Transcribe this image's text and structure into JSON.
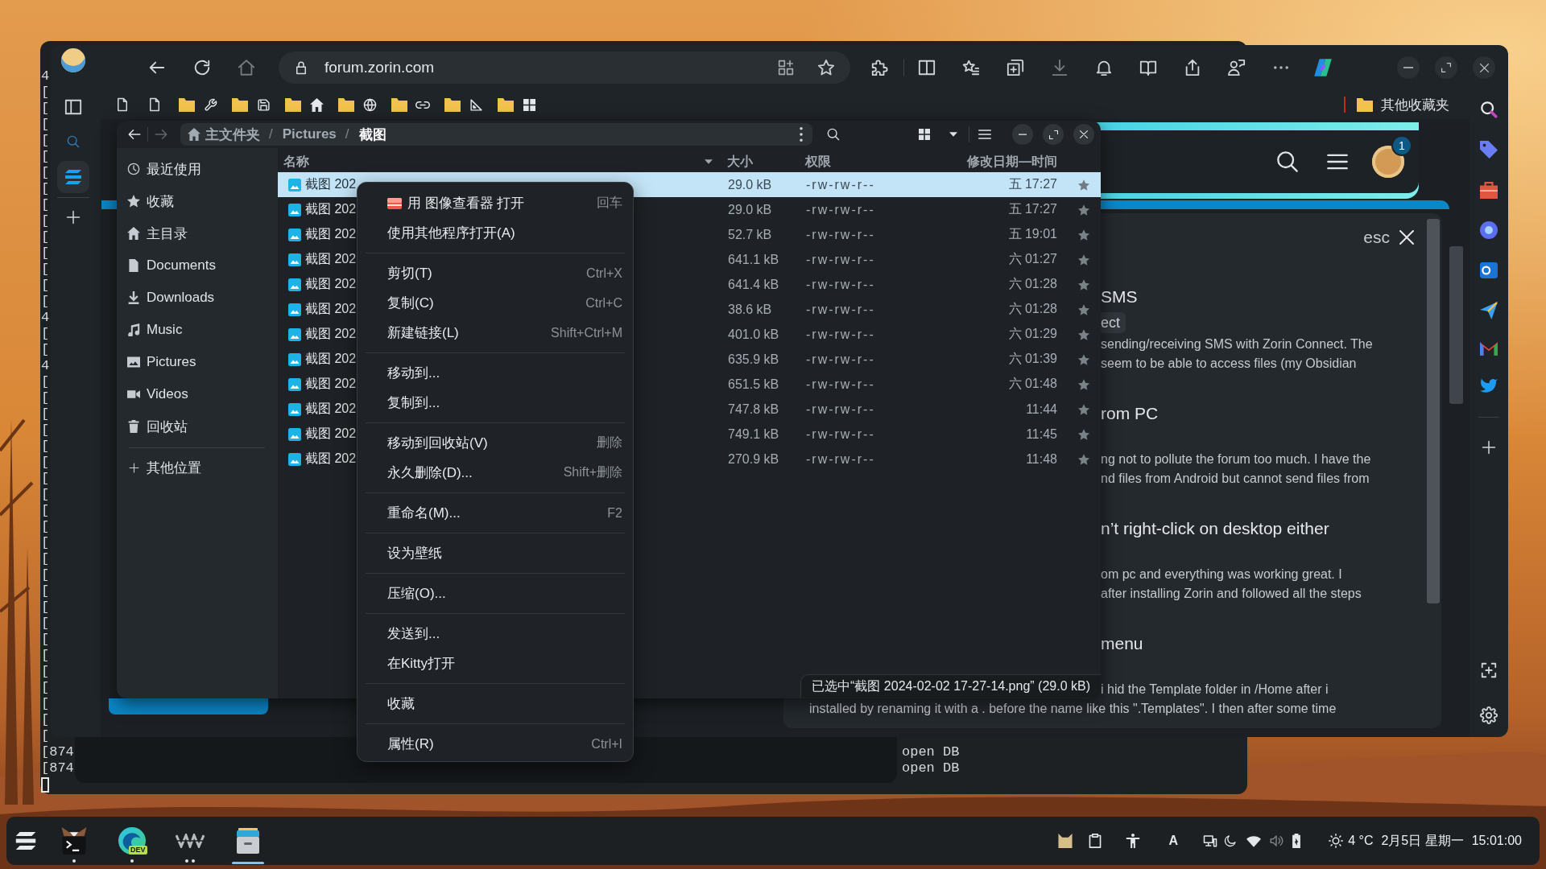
{
  "terminal": {
    "edge_lines": [
      "4",
      "[",
      "[",
      "[",
      "[",
      "[",
      "[",
      "[",
      "[",
      "[",
      "[",
      "[",
      "[",
      "[",
      "[",
      "4",
      "[",
      "[",
      "4",
      "[",
      "[",
      "[",
      "[",
      "[",
      "[",
      "[",
      "[",
      "[",
      "[",
      "[",
      "[",
      "[",
      "[",
      "[",
      "[",
      "[",
      "[",
      "[",
      "[",
      "[",
      "[",
      "["
    ],
    "bottom_lines": [
      {
        "start": "[874",
        "end": "open DB"
      },
      {
        "start": "[874",
        "end": "open DB"
      }
    ]
  },
  "browser": {
    "address": "forum.zorin.com",
    "other_bookmarks": "其他收藏夹",
    "page": {
      "notification_count": "1",
      "close_hint": "esc",
      "results": [
        {
          "kind": "heading",
          "text": "SMS"
        },
        {
          "kind": "tag",
          "text": "ect"
        },
        {
          "kind": "text",
          "text": "sending/receiving SMS with Zorin Connect. The"
        },
        {
          "kind": "text",
          "text": "seem to be able to access files (my Obsidian"
        },
        {
          "kind": "heading",
          "text": "rom PC"
        },
        {
          "kind": "text",
          "text": "ng not to pollute the forum too much. I have the"
        },
        {
          "kind": "text",
          "text": "nd files from Android but cannot send files from"
        },
        {
          "kind": "heading",
          "text": "n’t right-click on desktop either"
        },
        {
          "kind": "text",
          "text": "om pc and everything was working great. I"
        },
        {
          "kind": "text",
          "text": "after installing Zorin and followed all the steps"
        },
        {
          "kind": "heading",
          "text": "menu"
        },
        {
          "kind": "text",
          "text": "i hid the Template folder in /Home after i"
        }
      ],
      "last_line": "installed by renaming it with a . before the name like this \".Templates\". I then after some time"
    }
  },
  "file_manager": {
    "forward_disabled": true,
    "path": [
      {
        "kind": "home",
        "label": "主文件夹",
        "selected": false
      },
      {
        "kind": "folder",
        "separator": "/",
        "label": "Pictures",
        "selected": false
      },
      {
        "kind": "folder",
        "separator": "/",
        "label": "截图",
        "selected": true
      }
    ],
    "sidebar": [
      {
        "label": "最近使用",
        "selected": false
      },
      {
        "label": "收藏",
        "selected": false
      },
      {
        "label": "主目录",
        "selected": false
      },
      {
        "label": "Documents",
        "selected": false
      },
      {
        "label": "Downloads",
        "selected": false
      },
      {
        "label": "Music",
        "selected": false
      },
      {
        "label": "Pictures",
        "selected": false
      },
      {
        "label": "Videos",
        "selected": false
      },
      {
        "label": "回收站",
        "selected": false
      }
    ],
    "other_places": {
      "label": "其他位置",
      "selected": false
    },
    "columns": [
      {
        "label": "名称",
        "sorted": true
      },
      {
        "label": "大小",
        "sorted": false
      },
      {
        "label": "权限",
        "sorted": false
      },
      {
        "label": "修改日期—时间",
        "sorted": false
      }
    ],
    "rows": [
      {
        "name": "截图 202",
        "size": "29.0 kB",
        "permissions": "-rw-rw-r--",
        "modified": "五 17:27",
        "selected": true
      },
      {
        "name": "截图 202",
        "size": "29.0 kB",
        "permissions": "-rw-rw-r--",
        "modified": "五 17:27",
        "selected": false
      },
      {
        "name": "截图 202",
        "size": "52.7 kB",
        "permissions": "-rw-rw-r--",
        "modified": "五 19:01",
        "selected": false
      },
      {
        "name": "截图 202",
        "size": "641.1 kB",
        "permissions": "-rw-rw-r--",
        "modified": "六 01:27",
        "selected": false
      },
      {
        "name": "截图 202",
        "size": "641.4 kB",
        "permissions": "-rw-rw-r--",
        "modified": "六 01:28",
        "selected": false
      },
      {
        "name": "截图 202",
        "size": "38.6 kB",
        "permissions": "-rw-rw-r--",
        "modified": "六 01:28",
        "selected": false
      },
      {
        "name": "截图 202",
        "size": "401.0 kB",
        "permissions": "-rw-rw-r--",
        "modified": "六 01:29",
        "selected": false
      },
      {
        "name": "截图 202",
        "size": "635.9 kB",
        "permissions": "-rw-rw-r--",
        "modified": "六 01:39",
        "selected": false
      },
      {
        "name": "截图 202",
        "size": "651.5 kB",
        "permissions": "-rw-rw-r--",
        "modified": "六 01:48",
        "selected": false
      },
      {
        "name": "截图 202",
        "size": "747.8 kB",
        "permissions": "-rw-rw-r--",
        "modified": "11:44",
        "selected": false
      },
      {
        "name": "截图 202",
        "size": "749.1 kB",
        "permissions": "-rw-rw-r--",
        "modified": "11:45",
        "selected": false
      },
      {
        "name": "截图 202",
        "size": "270.9 kB",
        "permissions": "-rw-rw-r--",
        "modified": "11:48",
        "selected": false
      }
    ],
    "status": "已选中“截图 2024-02-02 17-27-14.png” (29.0 kB)"
  },
  "context_menu": {
    "groups": [
      [
        {
          "kind": "app",
          "label": "用 图像查看器 打开",
          "shortcut": "回车"
        },
        {
          "kind": "plain",
          "label": "使用其他程序打开(A)"
        }
      ],
      [
        {
          "kind": "plain",
          "label": "剪切(T)",
          "shortcut": "Ctrl+X"
        },
        {
          "kind": "plain",
          "label": "复制(C)",
          "shortcut": "Ctrl+C"
        },
        {
          "kind": "plain",
          "label": "新建链接(L)",
          "shortcut": "Shift+Ctrl+M"
        }
      ],
      [
        {
          "kind": "plain",
          "label": "移动到..."
        },
        {
          "kind": "plain",
          "label": "复制到..."
        }
      ],
      [
        {
          "kind": "plain",
          "label": "移动到回收站(V)",
          "shortcut": "删除"
        },
        {
          "kind": "plain",
          "label": "永久删除(D)...",
          "shortcut": "Shift+删除"
        }
      ],
      [
        {
          "kind": "plain",
          "label": "重命名(M)...",
          "shortcut": "F2"
        }
      ],
      [
        {
          "kind": "plain",
          "label": "设为壁纸"
        }
      ],
      [
        {
          "kind": "plain",
          "label": "压缩(O)..."
        }
      ],
      [
        {
          "kind": "plain",
          "label": "发送到..."
        },
        {
          "kind": "plain",
          "label": "在Kitty打开"
        }
      ],
      [
        {
          "kind": "plain",
          "label": "收藏"
        }
      ],
      [
        {
          "kind": "plain",
          "label": "属性(R)",
          "shortcut": "Ctrl+I"
        }
      ]
    ]
  },
  "taskbar": {
    "apps": [
      {
        "running": true,
        "multiple": false,
        "active": false
      },
      {
        "badge": "DEV",
        "running": true,
        "multiple": false,
        "active": false
      },
      {
        "running": true,
        "multiple": true,
        "active": false
      },
      {
        "running": true,
        "multiple": false,
        "active": true
      }
    ],
    "input_method": "A",
    "temperature": "4 °C",
    "date": "2月5日 星期一",
    "time": "15:01:00"
  }
}
